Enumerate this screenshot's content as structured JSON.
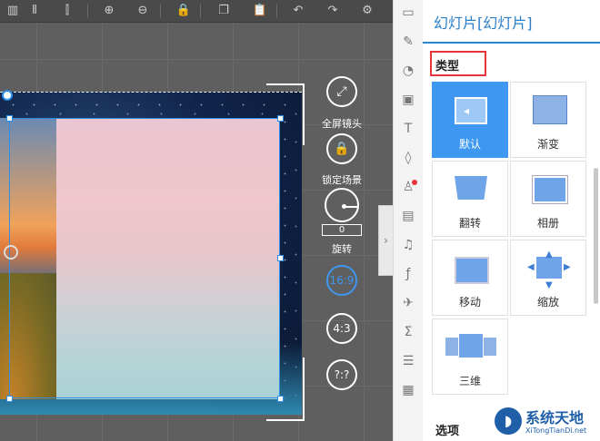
{
  "toolbar": {
    "icons": [
      "align-left-icon",
      "align-bottom-icon",
      "distribute-icon",
      "zoom-in-icon",
      "zoom-out-icon",
      "lock-icon",
      "copy-icon",
      "paste-icon",
      "undo-icon",
      "redo-icon",
      "settings-icon"
    ]
  },
  "camera_controls": {
    "fullscreen_label": "全屏镜头",
    "lock_scene_label": "锁定场景",
    "rotation_value": "0",
    "rotate_label": "旋转",
    "ratio_16_9": "16:9",
    "ratio_4_3": "4:3",
    "ratio_custom": "?:?"
  },
  "panel": {
    "title": "幻灯片[幻灯片]",
    "type_heading": "类型",
    "options_heading": "选项",
    "tiles": [
      {
        "label": "默认",
        "selected": true
      },
      {
        "label": "渐变",
        "selected": false
      },
      {
        "label": "翻转",
        "selected": false
      },
      {
        "label": "相册",
        "selected": false
      },
      {
        "label": "移动",
        "selected": false
      },
      {
        "label": "缩放",
        "selected": false
      },
      {
        "label": "三维",
        "selected": false
      }
    ]
  },
  "watermark": {
    "brand": "系统天地",
    "url": "XiTongTianDi.net"
  },
  "colors": {
    "accent": "#3e97f0",
    "highlight": "#e5343a",
    "title": "#2a7fc9"
  }
}
